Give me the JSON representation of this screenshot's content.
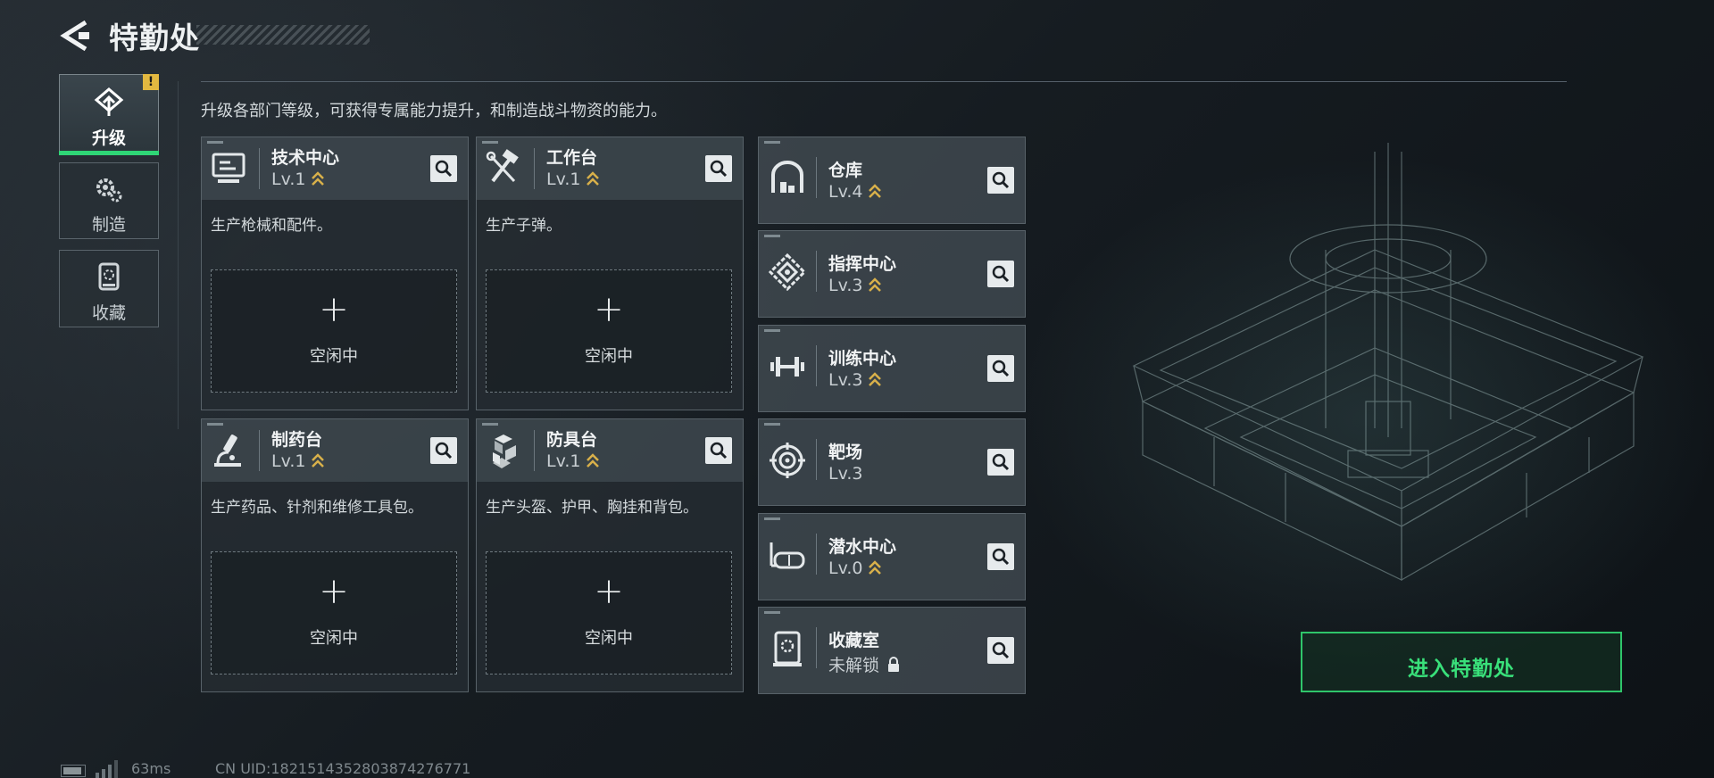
{
  "header": {
    "title": "特勤处"
  },
  "nav": [
    {
      "label": "升级",
      "icon": "upgrade-icon",
      "active": true,
      "badge": "!"
    },
    {
      "label": "制造",
      "icon": "gears-icon"
    },
    {
      "label": "收藏",
      "icon": "collection-icon"
    }
  ],
  "description": "升级各部门等级，可获得专属能力提升，和制造战斗物资的能力。",
  "production_cards": [
    {
      "name": "技术中心",
      "level": "Lv.1",
      "desc": "生产枪械和配件。",
      "plus": "+",
      "status": "空闲中",
      "icon": "monitor-icon"
    },
    {
      "name": "工作台",
      "level": "Lv.1",
      "desc": "生产子弹。",
      "plus": "+",
      "status": "空闲中",
      "icon": "hammer-wrench-icon"
    },
    {
      "name": "制药台",
      "level": "Lv.1",
      "desc": "生产药品、针剂和维修工具包。",
      "plus": "+",
      "status": "空闲中",
      "icon": "microscope-icon"
    },
    {
      "name": "防具台",
      "level": "Lv.1",
      "desc": "生产头盔、护甲、胸挂和背包。",
      "plus": "+",
      "status": "空闲中",
      "icon": "boxes-icon"
    }
  ],
  "facility_cards": [
    {
      "name": "仓库",
      "level": "Lv.4",
      "icon": "warehouse-icon"
    },
    {
      "name": "指挥中心",
      "level": "Lv.3",
      "icon": "command-icon"
    },
    {
      "name": "训练中心",
      "level": "Lv.3",
      "icon": "dumbbell-icon"
    },
    {
      "name": "靶场",
      "level": "Lv.3",
      "icon": "target-icon"
    },
    {
      "name": "潜水中心",
      "level": "Lv.0",
      "icon": "diving-mask-icon"
    },
    {
      "name": "收藏室",
      "level": "未解锁",
      "icon": "vault-icon"
    }
  ],
  "enter_button": "进入特勤处",
  "status_bar": {
    "ping": "63ms",
    "uid": "CN UID:1821514352803874276771"
  },
  "colors": {
    "accent_green": "#2fd676",
    "upgrade_chevron": "#d8b04a",
    "badge": "#e2b840"
  }
}
